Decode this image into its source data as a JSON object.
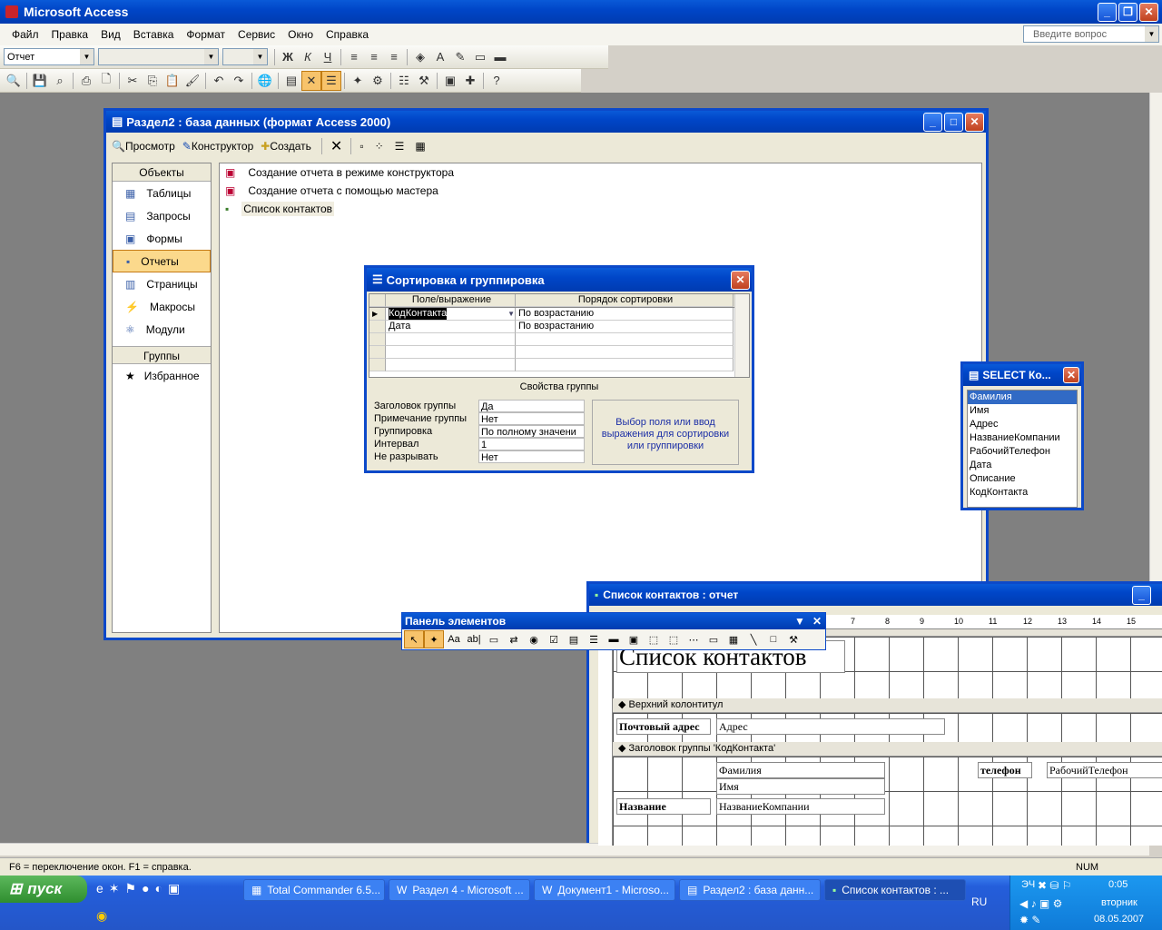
{
  "app": {
    "title": "Microsoft Access",
    "help_placeholder": "Введите вопрос"
  },
  "menu": [
    "Файл",
    "Правка",
    "Вид",
    "Вставка",
    "Формат",
    "Сервис",
    "Окно",
    "Справка"
  ],
  "formatting": {
    "object_combo": "Отчет",
    "bold": "Ж",
    "italic": "К",
    "underline": "Ч"
  },
  "db_window": {
    "title": "Раздел2 : база данных (формат Access 2000)",
    "toolbar": {
      "preview": "Просмотр",
      "design": "Конструктор",
      "create": "Создать"
    },
    "objects_header": "Объекты",
    "objects": [
      "Таблицы",
      "Запросы",
      "Формы",
      "Отчеты",
      "Страницы",
      "Макросы",
      "Модули"
    ],
    "selected_object": "Отчеты",
    "groups_header": "Группы",
    "groups": [
      "Избранное"
    ],
    "items": [
      "Создание отчета в режиме конструктора",
      "Создание отчета с помощью мастера",
      "Список контактов"
    ]
  },
  "sort_dialog": {
    "title": "Сортировка и группировка",
    "col_field": "Поле/выражение",
    "col_order": "Порядок сортировки",
    "rows": [
      {
        "field": "КодКонтакта",
        "order": "По возрастанию"
      },
      {
        "field": "Дата",
        "order": "По возрастанию"
      }
    ],
    "props_title": "Свойства группы",
    "props": [
      {
        "name": "Заголовок группы",
        "value": "Да"
      },
      {
        "name": "Примечание группы",
        "value": "Нет"
      },
      {
        "name": "Группировка",
        "value": "По полному значени"
      },
      {
        "name": "Интервал",
        "value": "1"
      },
      {
        "name": "Не разрывать",
        "value": "Нет"
      }
    ],
    "hint": "Выбор поля или ввод выражения для сортировки или группировки"
  },
  "field_list": {
    "title": "SELECT Ко...",
    "fields": [
      "Фамилия",
      "Имя",
      "Адрес",
      "НазваниеКомпании",
      "РабочийТелефон",
      "Дата",
      "Описание",
      "КодКонтакта"
    ]
  },
  "report": {
    "title": "Список контактов : отчет",
    "ruler": [
      "7",
      "8",
      "9",
      "10",
      "11",
      "12",
      "13",
      "14",
      "15"
    ],
    "heading": "Список контактов",
    "page_header": "Верхний колонтитул",
    "group_header": "Заголовок группы 'КодКонтакта'",
    "label_address": "Почтовый адрес",
    "field_address": "Адрес",
    "field_lastname": "Фамилия",
    "field_firstname": "Имя",
    "label_phone": "телефон",
    "field_phone": "РабочийТелефон",
    "label_company": "Название",
    "field_company": "НазваниеКомпании"
  },
  "toolbox": {
    "title": "Панель элементов"
  },
  "status": {
    "text": "F6 = переключение окон.  F1 = справка.",
    "num": "NUM"
  },
  "taskbar": {
    "start": "пуск",
    "tasks": [
      "Total Commander 6.5...",
      "Раздел 4 - Microsoft ...",
      "Документ1 - Microso...",
      "Раздел2 : база данн...",
      "Список контактов : ..."
    ],
    "lang": "RU",
    "lang_tray": "ЭЧ",
    "time": "0:05",
    "day": "вторник",
    "date": "08.05.2007"
  }
}
